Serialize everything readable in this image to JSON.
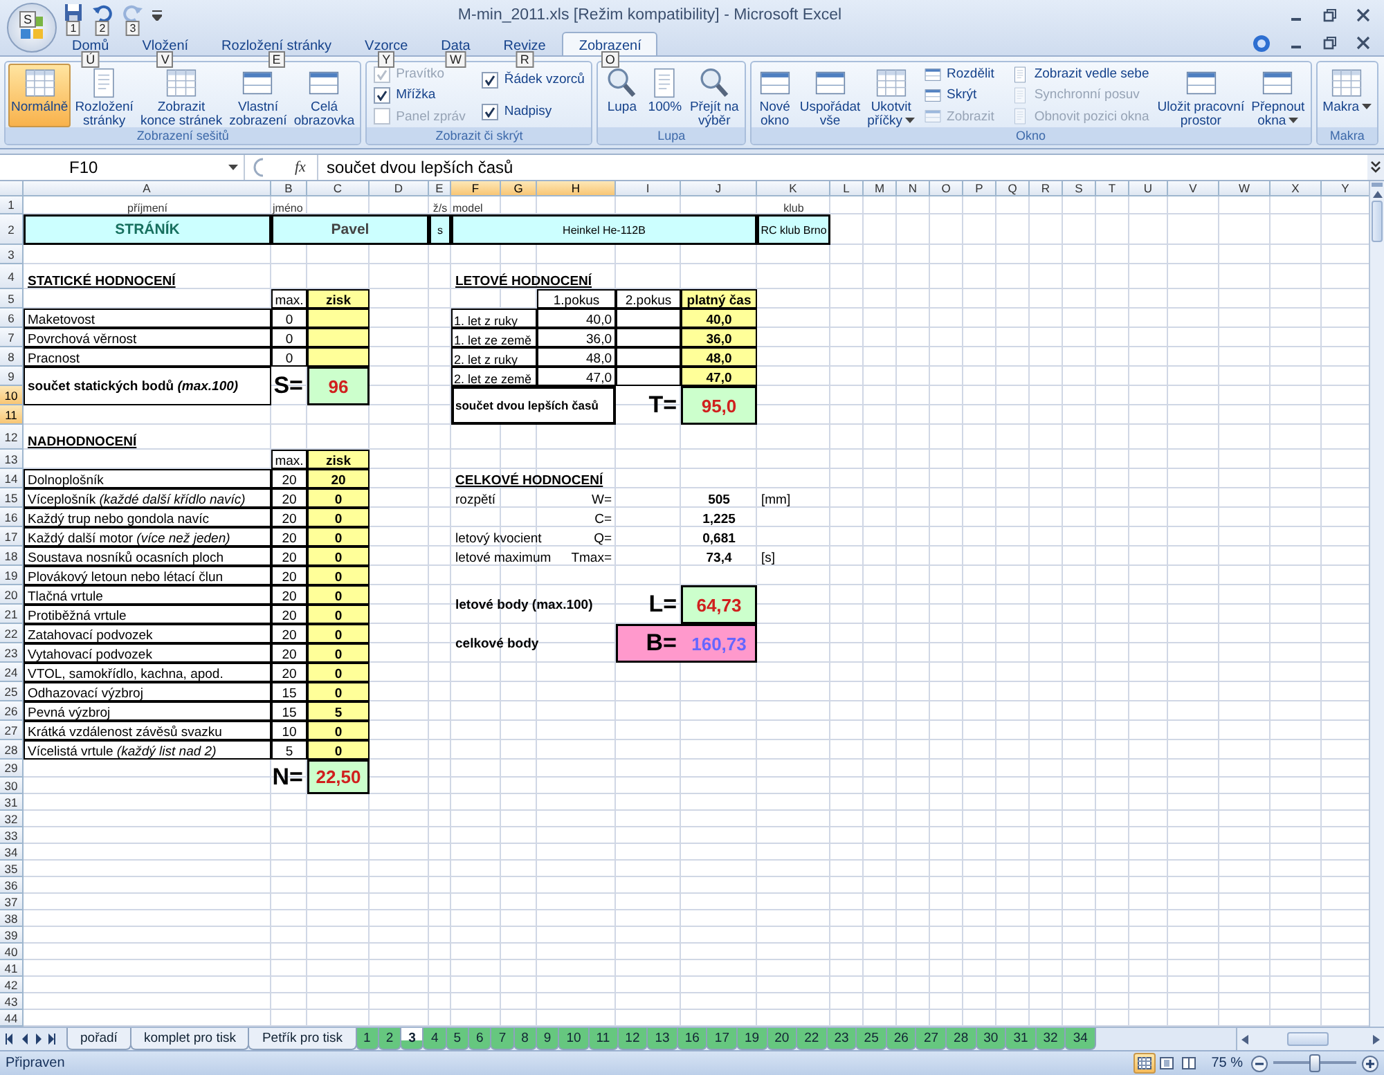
{
  "window": {
    "title": "M-min_2011.xls  [Režim kompatibility] - Microsoft Excel",
    "menu_keytip": "S",
    "quick_access": [
      {
        "keytip": "1",
        "disabled": false
      },
      {
        "keytip": "2",
        "disabled": false
      },
      {
        "keytip": "3",
        "disabled": true
      }
    ]
  },
  "ribbon": {
    "tabs": [
      {
        "label": "Domů",
        "keytip": "Ú",
        "selected": false
      },
      {
        "label": "Vložení",
        "keytip": "V",
        "selected": false
      },
      {
        "label": "Rozložení stránky",
        "keytip": "E",
        "selected": false
      },
      {
        "label": "Vzorce",
        "keytip": "Y",
        "selected": false
      },
      {
        "label": "Data",
        "keytip": "W",
        "selected": false
      },
      {
        "label": "Revize",
        "keytip": "R",
        "selected": false
      },
      {
        "label": "Zobrazení",
        "keytip": "O",
        "selected": true
      }
    ],
    "groups": [
      {
        "label": "Zobrazení sešitů",
        "items": [
          {
            "kind": "big",
            "label": "Normálně",
            "selected": true
          },
          {
            "kind": "big",
            "label": "Rozložení\nstránky",
            "selected": false
          },
          {
            "kind": "big",
            "label": "Zobrazit\nkonce stránek",
            "selected": false
          },
          {
            "kind": "big",
            "label": "Vlastní\nzobrazení",
            "selected": false
          },
          {
            "kind": "big",
            "label": "Celá\nobrazovka",
            "selected": false
          }
        ]
      },
      {
        "label": "Zobrazit či skrýt",
        "items": [
          {
            "kind": "check",
            "label": "Pravítko",
            "checked": true,
            "disabled": true
          },
          {
            "kind": "check",
            "label": "Mřížka",
            "checked": true,
            "disabled": false
          },
          {
            "kind": "check",
            "label": "Panel zpráv",
            "checked": false,
            "disabled": true
          },
          {
            "kind": "check",
            "label": "Řádek vzorců",
            "checked": true,
            "disabled": false
          },
          {
            "kind": "check",
            "label": "Nadpisy",
            "checked": true,
            "disabled": false
          }
        ]
      },
      {
        "label": "Lupa",
        "items": [
          {
            "kind": "big",
            "label": "Lupa"
          },
          {
            "kind": "big",
            "label": "100%"
          },
          {
            "kind": "big",
            "label": "Přejít na\nvýběr"
          }
        ]
      },
      {
        "label": "Okno",
        "items": [
          {
            "kind": "big",
            "label": "Nové\nokno"
          },
          {
            "kind": "big",
            "label": "Uspořádat\nvše"
          },
          {
            "kind": "big",
            "label": "Ukotvit\npříčky",
            "dropdown": true
          },
          {
            "kind": "small",
            "label": "Rozdělit",
            "disabled": false
          },
          {
            "kind": "small",
            "label": "Skrýt",
            "disabled": false
          },
          {
            "kind": "small",
            "label": "Zobrazit",
            "disabled": true
          },
          {
            "kind": "small",
            "label": "Zobrazit vedle sebe",
            "disabled": false
          },
          {
            "kind": "small",
            "label": "Synchronní posuv",
            "disabled": true
          },
          {
            "kind": "small",
            "label": "Obnovit pozici okna",
            "disabled": true
          },
          {
            "kind": "big",
            "label": "Uložit pracovní\nprostor"
          },
          {
            "kind": "big",
            "label": "Přepnout\nokna",
            "dropdown": true
          }
        ]
      },
      {
        "label": "Makra",
        "items": [
          {
            "kind": "big",
            "label": "Makra",
            "dropdown": true
          }
        ]
      }
    ]
  },
  "formula_bar": {
    "name_box": "F10",
    "function_label": "fx",
    "formula": "součet dvou lepších časů"
  },
  "sheet": {
    "columns": [
      {
        "label": "A",
        "selected": false
      },
      {
        "label": "B",
        "selected": false
      },
      {
        "label": "C",
        "selected": false
      },
      {
        "label": "D",
        "selected": false
      },
      {
        "label": "E",
        "selected": false
      },
      {
        "label": "F",
        "selected": true
      },
      {
        "label": "G",
        "selected": true
      },
      {
        "label": "H",
        "selected": true
      },
      {
        "label": "I",
        "selected": false
      },
      {
        "label": "J",
        "selected": false
      },
      {
        "label": "K",
        "selected": false
      },
      {
        "label": "L",
        "selected": false
      },
      {
        "label": "M",
        "selected": false
      },
      {
        "label": "N",
        "selected": false
      },
      {
        "label": "O",
        "selected": false
      },
      {
        "label": "P",
        "selected": false
      },
      {
        "label": "Q",
        "selected": false
      },
      {
        "label": "R",
        "selected": false
      },
      {
        "label": "S",
        "selected": false
      },
      {
        "label": "T",
        "selected": false
      },
      {
        "label": "U",
        "selected": false
      },
      {
        "label": "V",
        "selected": false
      },
      {
        "label": "W",
        "selected": false
      },
      {
        "label": "X",
        "selected": false
      },
      {
        "label": "Y",
        "selected": false
      }
    ],
    "rows": [
      {
        "label": "1",
        "selected": false
      },
      {
        "label": "2",
        "selected": false
      },
      {
        "label": "3",
        "selected": false
      },
      {
        "label": "4",
        "selected": false
      },
      {
        "label": "5",
        "selected": false
      },
      {
        "label": "6",
        "selected": false
      },
      {
        "label": "7",
        "selected": false
      },
      {
        "label": "8",
        "selected": false
      },
      {
        "label": "9",
        "selected": false
      },
      {
        "label": "10",
        "selected": true
      },
      {
        "label": "11",
        "selected": true
      },
      {
        "label": "12",
        "selected": false
      },
      {
        "label": "13",
        "selected": false
      },
      {
        "label": "14",
        "selected": false
      },
      {
        "label": "15",
        "selected": false
      },
      {
        "label": "16",
        "selected": false
      },
      {
        "label": "17",
        "selected": false
      },
      {
        "label": "18",
        "selected": false
      },
      {
        "label": "19",
        "selected": false
      },
      {
        "label": "20",
        "selected": false
      },
      {
        "label": "21",
        "selected": false
      },
      {
        "label": "22",
        "selected": false
      },
      {
        "label": "23",
        "selected": false
      },
      {
        "label": "24",
        "selected": false
      },
      {
        "label": "25",
        "selected": false
      },
      {
        "label": "26",
        "selected": false
      },
      {
        "label": "27",
        "selected": false
      },
      {
        "label": "28",
        "selected": false
      },
      {
        "label": "29",
        "selected": false
      },
      {
        "label": "30",
        "selected": false
      },
      {
        "label": "31",
        "selected": false
      },
      {
        "label": "32",
        "selected": false
      },
      {
        "label": "33",
        "selected": false
      },
      {
        "label": "34",
        "selected": false
      },
      {
        "label": "35",
        "selected": false
      },
      {
        "label": "36",
        "selected": false
      },
      {
        "label": "37",
        "selected": false
      },
      {
        "label": "38",
        "selected": false
      },
      {
        "label": "39",
        "selected": false
      },
      {
        "label": "40",
        "selected": false
      },
      {
        "label": "41",
        "selected": false
      },
      {
        "label": "42",
        "selected": false
      },
      {
        "label": "43",
        "selected": false
      },
      {
        "label": "44",
        "selected": false
      }
    ],
    "entry": [
      {
        "caption": "příjmení",
        "value": "STRÁNÍK"
      },
      {
        "caption": "jméno",
        "value": "Pavel"
      },
      {
        "caption": "ž/s",
        "value": "s"
      },
      {
        "caption": "model",
        "value": "Heinkel He-112B"
      },
      {
        "caption": "klub",
        "value": "RC klub Brno"
      }
    ],
    "static": {
      "title": "STATICKÉ HODNOCENÍ",
      "max_heading": "max.",
      "score_heading": "zisk",
      "items": [
        {
          "label": "Maketovost",
          "max": "0"
        },
        {
          "label": "Povrchová věrnost",
          "max": "0"
        },
        {
          "label": "Pracnost",
          "max": "0"
        }
      ],
      "total_label": "**součet statických bodů** *(max.100)*",
      "total_symbol": "S=",
      "total": "96"
    },
    "flight": {
      "title": "LETOVÉ HODNOCENÍ",
      "headings": [
        "1.pokus",
        "2.pokus",
        "platný čas"
      ],
      "items": [
        {
          "label": "1. let z ruky",
          "attempt_1": "40,0",
          "valid": "40,0"
        },
        {
          "label": "1. let ze země",
          "attempt_1": "36,0",
          "valid": "36,0"
        },
        {
          "label": "2. let z ruky",
          "attempt_1": "48,0",
          "valid": "48,0"
        },
        {
          "label": "2. let ze země",
          "attempt_1": "47,0",
          "valid": "47,0"
        }
      ],
      "total_label": "součet dvou lepších časů",
      "total_symbol": "T=",
      "total": "95,0"
    },
    "bonus": {
      "title": "NADHODNOCENÍ",
      "max_heading": "max.",
      "score_heading": "zisk",
      "items": [
        {
          "label": "Dolnoplošník",
          "max": "20",
          "score": "20"
        },
        {
          "label": "Víceplošník *(každé další křídlo navíc)*",
          "max": "20",
          "score": "0"
        },
        {
          "label": "Každý trup nebo gondola navíc",
          "max": "20",
          "score": "0"
        },
        {
          "label": "Každý další motor *(více než jeden)*",
          "max": "20",
          "score": "0"
        },
        {
          "label": "Soustava nosníků ocasních ploch",
          "max": "20",
          "score": "0"
        },
        {
          "label": "Plovákový letoun nebo létací člun",
          "max": "20",
          "score": "0"
        },
        {
          "label": "Tlačná vrtule",
          "max": "20",
          "score": "0"
        },
        {
          "label": "Protiběžná vrtule",
          "max": "20",
          "score": "0"
        },
        {
          "label": "Zatahovací podvozek",
          "max": "20",
          "score": "0"
        },
        {
          "label": "Vytahovací podvozek",
          "max": "20",
          "score": "0"
        },
        {
          "label": "VTOL, samokřídlo, kachna, apod.",
          "max": "20",
          "score": "0"
        },
        {
          "label": "Odhazovací výzbroj",
          "max": "15",
          "score": "0"
        },
        {
          "label": "Pevná výzbroj",
          "max": "15",
          "score": "5"
        },
        {
          "label": "Krátká vzdálenost závěsů svazku",
          "max": "10",
          "score": "0"
        },
        {
          "label": "Vícelistá vrtule *(každý list nad 2)*",
          "max": "5",
          "score": "0"
        }
      ],
      "total_symbol": "N=",
      "total": "22,50"
    },
    "overall": {
      "title": "CELKOVÉ HODNOCENÍ",
      "items": [
        {
          "label": "rozpětí",
          "symbol": "W=",
          "value": "505",
          "unit": "[mm]"
        },
        {
          "symbol": "C=",
          "value": "1,225"
        },
        {
          "label": "letový kvocient",
          "symbol": "Q=",
          "value": "0,681"
        },
        {
          "label": "letové maximum",
          "symbol": "Tmax=",
          "value": "73,4",
          "unit": "[s]"
        }
      ],
      "results": [
        {
          "kind": "flight",
          "label": "letové body (max.100)",
          "symbol": "L=",
          "value": "64,73"
        },
        {
          "kind": "total",
          "label": "celkové body",
          "symbol": "B=",
          "value": "160,73"
        }
      ]
    }
  },
  "sheet_tabs": [
    {
      "label": "pořadí",
      "selected": false
    },
    {
      "label": "komplet pro tisk",
      "selected": false
    },
    {
      "label": "Petřík pro tisk",
      "selected": false
    },
    {
      "label": "1",
      "selected": false,
      "color": "#66c77f"
    },
    {
      "label": "2",
      "selected": false,
      "color": "#66c77f"
    },
    {
      "label": "3",
      "selected": true,
      "color": "#66c77f"
    },
    {
      "label": "4",
      "selected": false,
      "color": "#66c77f"
    },
    {
      "label": "5",
      "selected": false,
      "color": "#66c77f"
    },
    {
      "label": "6",
      "selected": false,
      "color": "#66c77f"
    },
    {
      "label": "7",
      "selected": false,
      "color": "#66c77f"
    },
    {
      "label": "8",
      "selected": false,
      "color": "#66c77f"
    },
    {
      "label": "9",
      "selected": false,
      "color": "#66c77f"
    },
    {
      "label": "10",
      "selected": false,
      "color": "#66c77f"
    },
    {
      "label": "11",
      "selected": false,
      "color": "#66c77f"
    },
    {
      "label": "12",
      "selected": false,
      "color": "#66c77f"
    },
    {
      "label": "13",
      "selected": false,
      "color": "#66c77f"
    },
    {
      "label": "16",
      "selected": false,
      "color": "#66c77f"
    },
    {
      "label": "17",
      "selected": false,
      "color": "#66c77f"
    },
    {
      "label": "19",
      "selected": false,
      "color": "#66c77f"
    },
    {
      "label": "20",
      "selected": false,
      "color": "#66c77f"
    },
    {
      "label": "22",
      "selected": false,
      "color": "#66c77f"
    },
    {
      "label": "23",
      "selected": false,
      "color": "#66c77f"
    },
    {
      "label": "25",
      "selected": false,
      "color": "#66c77f"
    },
    {
      "label": "26",
      "selected": false,
      "color": "#66c77f"
    },
    {
      "label": "27",
      "selected": false,
      "color": "#66c77f"
    },
    {
      "label": "28",
      "selected": false,
      "color": "#66c77f"
    },
    {
      "label": "30",
      "selected": false,
      "color": "#66c77f"
    },
    {
      "label": "31",
      "selected": false,
      "color": "#66c77f"
    },
    {
      "label": "32",
      "selected": false,
      "color": "#66c77f"
    },
    {
      "label": "34",
      "selected": false,
      "color": "#66c77f"
    }
  ],
  "status_bar": {
    "text": "Připraven",
    "views": [
      {
        "selected": true
      },
      {
        "selected": false
      },
      {
        "selected": false
      }
    ],
    "zoom": "75 %",
    "zoom_slider": {
      "level": 0.5
    }
  }
}
